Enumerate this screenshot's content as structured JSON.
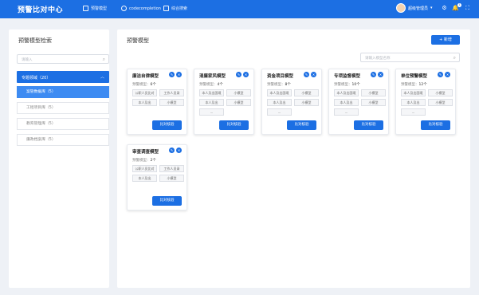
{
  "header": {
    "logo": "预警比对中心",
    "nav": [
      {
        "label": "预警模型",
        "icon": "model-icon"
      },
      {
        "label": "codecompletion",
        "icon": "task-icon"
      },
      {
        "label": "综合搜索",
        "icon": "search-icon"
      }
    ],
    "user": "超级管理员",
    "notifications": "1"
  },
  "sidebar": {
    "title": "预警模型检索",
    "search_placeholder": "请输入",
    "group": {
      "label": "专题领域（20）"
    },
    "items": [
      {
        "label": "案管数据库（5）"
      },
      {
        "label": "工程项目库（5）"
      },
      {
        "label": "教育管理库（5）"
      },
      {
        "label": "廉政档案库（5）"
      }
    ]
  },
  "main": {
    "title": "预警模型",
    "add_label": "+ 新增",
    "search_placeholder": "请输入模型名称",
    "count_prefix": "预警模型：",
    "compare_label": "比对核验",
    "cards": [
      {
        "title": "廉洁自律模型",
        "count": "6个",
        "tags": [
          "公职人员比对",
          "工作人员录",
          "本人及出",
          "小模型"
        ]
      },
      {
        "title": "清廉家风模型",
        "count": "4个",
        "tags": [
          "本人及出国境",
          "小模型",
          "本人及出",
          "小模型",
          "..."
        ]
      },
      {
        "title": "资金项目模型",
        "count": "8个",
        "tags": [
          "本人及出国境",
          "小模型",
          "本人及出",
          "小模型",
          "..."
        ]
      },
      {
        "title": "专项监督模型",
        "count": "10个",
        "tags": [
          "本人及出国境",
          "小模型",
          "本人及出",
          "小模型",
          "..."
        ]
      },
      {
        "title": "单位预警模型",
        "count": "12个",
        "tags": [
          "本人及出国境",
          "小模型",
          "本人及出",
          "小模型",
          "..."
        ]
      },
      {
        "title": "审查调查模型",
        "count": "2个",
        "tags": [
          "公职人员比对",
          "工作人员录",
          "本人及出",
          "小模型"
        ]
      }
    ]
  }
}
